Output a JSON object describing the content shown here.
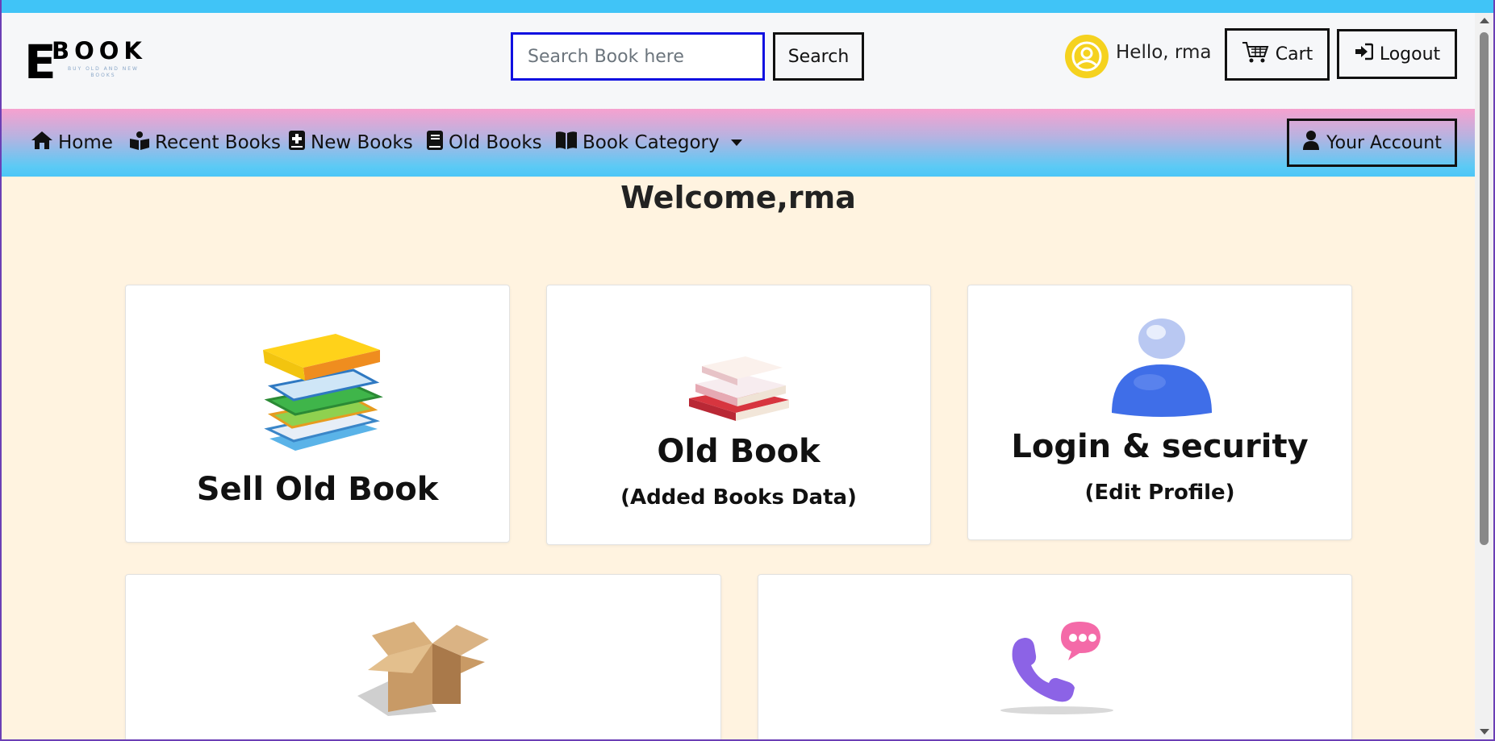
{
  "header": {
    "logo": {
      "main": "BOOK",
      "initial": "E",
      "tagline": "BUY OLD AND NEW BOOKS"
    },
    "search": {
      "placeholder": "Search Book here",
      "value": "",
      "button_label": "Search"
    },
    "greeting": "Hello, rma",
    "cart_label": "Cart",
    "logout_label": "Logout"
  },
  "nav": {
    "items": [
      {
        "label": "Home",
        "icon": "home-icon"
      },
      {
        "label": "Recent Books",
        "icon": "open-book-icon"
      },
      {
        "label": "New Books",
        "icon": "book-plus-icon"
      },
      {
        "label": "Old Books",
        "icon": "book-icon"
      },
      {
        "label": "Book Category",
        "icon": "book-open-icon",
        "dropdown": true
      }
    ],
    "account_label": "Your Account"
  },
  "main": {
    "welcome": "Welcome,rma",
    "cards": [
      {
        "title": "Sell Old Book",
        "subtitle": "",
        "icon": "book-stack-icon"
      },
      {
        "title": "Old Book",
        "subtitle": "(Added Books Data)",
        "icon": "old-books-icon"
      },
      {
        "title": "Login & security",
        "subtitle": "(Edit Profile)",
        "icon": "user-3d-icon"
      },
      {
        "title": "",
        "subtitle": "",
        "icon": "open-box-icon"
      },
      {
        "title": "",
        "subtitle": "",
        "icon": "phone-chat-icon"
      }
    ]
  },
  "colors": {
    "top_strip": "#40c4f7",
    "nav_gradient_top": "#f7a1cf",
    "nav_gradient_bottom": "#4cc6f7",
    "page_background": "#fff3e0",
    "search_border": "#1010e0",
    "user_badge": "#f5d21f"
  }
}
